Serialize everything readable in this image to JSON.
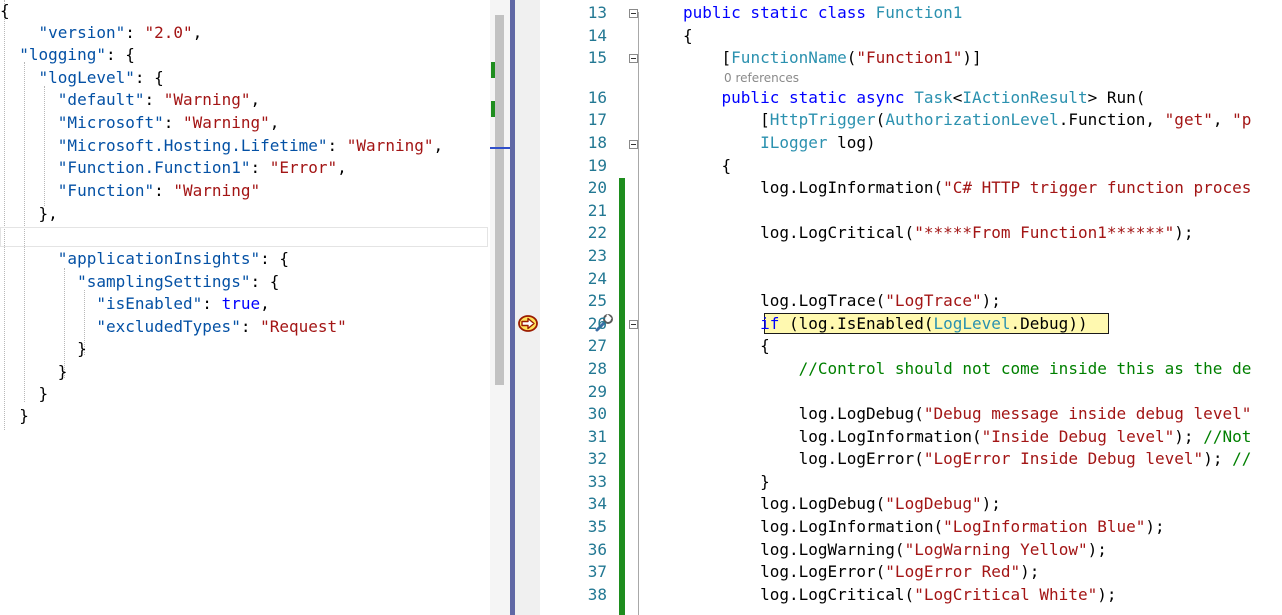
{
  "json_editor": {
    "lines": [
      [
        {
          "t": "{",
          "c": "pl"
        }
      ],
      [
        {
          "t": "    ",
          "c": "pl"
        },
        {
          "t": "\"version\"",
          "c": "jk"
        },
        {
          "t": ": ",
          "c": "pl"
        },
        {
          "t": "\"2.0\"",
          "c": "jv"
        },
        {
          "t": ",",
          "c": "pl"
        }
      ],
      [
        {
          "t": "  ",
          "c": "pl"
        },
        {
          "t": "\"logging\"",
          "c": "jk"
        },
        {
          "t": ": {",
          "c": "pl"
        }
      ],
      [
        {
          "t": "    ",
          "c": "pl"
        },
        {
          "t": "\"logLevel\"",
          "c": "jk"
        },
        {
          "t": ": {",
          "c": "pl"
        }
      ],
      [
        {
          "t": "      ",
          "c": "pl"
        },
        {
          "t": "\"default\"",
          "c": "jk"
        },
        {
          "t": ": ",
          "c": "pl"
        },
        {
          "t": "\"Warning\"",
          "c": "jv"
        },
        {
          "t": ",",
          "c": "pl"
        }
      ],
      [
        {
          "t": "      ",
          "c": "pl"
        },
        {
          "t": "\"Microsoft\"",
          "c": "jk"
        },
        {
          "t": ": ",
          "c": "pl"
        },
        {
          "t": "\"Warning\"",
          "c": "jv"
        },
        {
          "t": ",",
          "c": "pl"
        }
      ],
      [
        {
          "t": "      ",
          "c": "pl"
        },
        {
          "t": "\"Microsoft.Hosting.Lifetime\"",
          "c": "jk"
        },
        {
          "t": ": ",
          "c": "pl"
        },
        {
          "t": "\"Warning\"",
          "c": "jv"
        },
        {
          "t": ",",
          "c": "pl"
        }
      ],
      [
        {
          "t": "      ",
          "c": "pl"
        },
        {
          "t": "\"Function.Function1\"",
          "c": "jk"
        },
        {
          "t": ": ",
          "c": "pl"
        },
        {
          "t": "\"Error\"",
          "c": "jv"
        },
        {
          "t": ",",
          "c": "pl"
        }
      ],
      [
        {
          "t": "      ",
          "c": "pl"
        },
        {
          "t": "\"Function\"",
          "c": "jk"
        },
        {
          "t": ": ",
          "c": "pl"
        },
        {
          "t": "\"Warning\"",
          "c": "jv"
        }
      ],
      [
        {
          "t": "    },",
          "c": "pl"
        }
      ],
      [
        {
          "t": "",
          "c": "pl"
        }
      ],
      [
        {
          "t": "      ",
          "c": "pl"
        },
        {
          "t": "\"applicationInsights\"",
          "c": "jk"
        },
        {
          "t": ": {",
          "c": "pl"
        }
      ],
      [
        {
          "t": "        ",
          "c": "pl"
        },
        {
          "t": "\"samplingSettings\"",
          "c": "jk"
        },
        {
          "t": ": {",
          "c": "pl"
        }
      ],
      [
        {
          "t": "          ",
          "c": "pl"
        },
        {
          "t": "\"isEnabled\"",
          "c": "jk"
        },
        {
          "t": ": ",
          "c": "pl"
        },
        {
          "t": "true",
          "c": "jb"
        },
        {
          "t": ",",
          "c": "pl"
        }
      ],
      [
        {
          "t": "          ",
          "c": "pl"
        },
        {
          "t": "\"excludedTypes\"",
          "c": "jk"
        },
        {
          "t": ": ",
          "c": "pl"
        },
        {
          "t": "\"Request\"",
          "c": "jv"
        }
      ],
      [
        {
          "t": "        }",
          "c": "pl"
        }
      ],
      [
        {
          "t": "      }",
          "c": "pl"
        }
      ],
      [
        {
          "t": "    }",
          "c": "pl"
        }
      ],
      [
        {
          "t": "  }",
          "c": "pl"
        }
      ]
    ]
  },
  "code_editor": {
    "codelens_text": "0 references",
    "lines": [
      {
        "n": "13",
        "s": [
          {
            "t": "public static class ",
            "c": "kw"
          },
          {
            "t": "Function1",
            "c": "ty"
          }
        ]
      },
      {
        "n": "14",
        "s": [
          {
            "t": "{",
            "c": "pl"
          }
        ]
      },
      {
        "n": "15",
        "s": [
          {
            "t": "    [",
            "c": "pl"
          },
          {
            "t": "FunctionName",
            "c": "ty"
          },
          {
            "t": "(",
            "c": "pl"
          },
          {
            "t": "\"Function1\"",
            "c": "st"
          },
          {
            "t": ")]",
            "c": "pl"
          }
        ]
      },
      {
        "n": "16",
        "s": [
          {
            "t": "    public static async ",
            "c": "kw"
          },
          {
            "t": "Task",
            "c": "ty"
          },
          {
            "t": "<",
            "c": "pl"
          },
          {
            "t": "IActionResult",
            "c": "ty"
          },
          {
            "t": "> Run(",
            "c": "pl"
          }
        ]
      },
      {
        "n": "17",
        "s": [
          {
            "t": "        [",
            "c": "pl"
          },
          {
            "t": "HttpTrigger",
            "c": "ty"
          },
          {
            "t": "(",
            "c": "pl"
          },
          {
            "t": "AuthorizationLevel",
            "c": "ty"
          },
          {
            "t": ".Function, ",
            "c": "pl"
          },
          {
            "t": "\"get\"",
            "c": "st"
          },
          {
            "t": ", ",
            "c": "pl"
          },
          {
            "t": "\"p",
            "c": "st"
          }
        ]
      },
      {
        "n": "18",
        "s": [
          {
            "t": "        ",
            "c": "pl"
          },
          {
            "t": "ILogger",
            "c": "ty"
          },
          {
            "t": " log)",
            "c": "pl"
          }
        ]
      },
      {
        "n": "19",
        "s": [
          {
            "t": "    {",
            "c": "pl"
          }
        ]
      },
      {
        "n": "20",
        "s": [
          {
            "t": "        log.LogInformation(",
            "c": "pl"
          },
          {
            "t": "\"C# HTTP trigger function proces",
            "c": "st"
          }
        ]
      },
      {
        "n": "21",
        "s": [
          {
            "t": "",
            "c": "pl"
          }
        ]
      },
      {
        "n": "22",
        "s": [
          {
            "t": "        log.LogCritical(",
            "c": "pl"
          },
          {
            "t": "\"*****From Function1******\"",
            "c": "st"
          },
          {
            "t": ");",
            "c": "pl"
          }
        ]
      },
      {
        "n": "23",
        "s": [
          {
            "t": "",
            "c": "pl"
          }
        ]
      },
      {
        "n": "24",
        "s": [
          {
            "t": "",
            "c": "pl"
          }
        ]
      },
      {
        "n": "25",
        "s": [
          {
            "t": "        log.LogTrace(",
            "c": "pl"
          },
          {
            "t": "\"LogTrace\"",
            "c": "st"
          },
          {
            "t": ");",
            "c": "pl"
          }
        ]
      },
      {
        "n": "26",
        "s": [
          {
            "t": "        ",
            "c": "pl"
          },
          {
            "t": "if",
            "c": "kw"
          },
          {
            "t": " (log.IsEnabled(",
            "c": "pl"
          },
          {
            "t": "LogLevel",
            "c": "ty"
          },
          {
            "t": ".Debug))",
            "c": "pl"
          }
        ]
      },
      {
        "n": "27",
        "s": [
          {
            "t": "        {",
            "c": "pl"
          }
        ]
      },
      {
        "n": "28",
        "s": [
          {
            "t": "            //Control should not come inside this as the de",
            "c": "cm"
          }
        ]
      },
      {
        "n": "29",
        "s": [
          {
            "t": "",
            "c": "pl"
          }
        ]
      },
      {
        "n": "30",
        "s": [
          {
            "t": "            log.LogDebug(",
            "c": "pl"
          },
          {
            "t": "\"Debug message inside debug level\"",
            "c": "st"
          }
        ]
      },
      {
        "n": "31",
        "s": [
          {
            "t": "            log.LogInformation(",
            "c": "pl"
          },
          {
            "t": "\"Inside Debug level\"",
            "c": "st"
          },
          {
            "t": "); ",
            "c": "pl"
          },
          {
            "t": "//Not",
            "c": "cm"
          }
        ]
      },
      {
        "n": "32",
        "s": [
          {
            "t": "            log.LogError(",
            "c": "pl"
          },
          {
            "t": "\"LogError Inside Debug level\"",
            "c": "st"
          },
          {
            "t": "); ",
            "c": "pl"
          },
          {
            "t": "//",
            "c": "cm"
          }
        ]
      },
      {
        "n": "33",
        "s": [
          {
            "t": "        }",
            "c": "pl"
          }
        ]
      },
      {
        "n": "34",
        "s": [
          {
            "t": "        log.LogDebug(",
            "c": "pl"
          },
          {
            "t": "\"LogDebug\"",
            "c": "st"
          },
          {
            "t": ");",
            "c": "pl"
          }
        ]
      },
      {
        "n": "35",
        "s": [
          {
            "t": "        log.LogInformation(",
            "c": "pl"
          },
          {
            "t": "\"LogInformation Blue\"",
            "c": "st"
          },
          {
            "t": ");",
            "c": "pl"
          }
        ]
      },
      {
        "n": "36",
        "s": [
          {
            "t": "        log.LogWarning(",
            "c": "pl"
          },
          {
            "t": "\"LogWarning Yellow\"",
            "c": "st"
          },
          {
            "t": ");",
            "c": "pl"
          }
        ]
      },
      {
        "n": "37",
        "s": [
          {
            "t": "        log.LogError(",
            "c": "pl"
          },
          {
            "t": "\"LogError Red\"",
            "c": "st"
          },
          {
            "t": ");",
            "c": "pl"
          }
        ]
      },
      {
        "n": "38",
        "s": [
          {
            "t": "        log.LogCritical(",
            "c": "pl"
          },
          {
            "t": "\"LogCritical White\"",
            "c": "st"
          },
          {
            "t": ");",
            "c": "pl"
          }
        ]
      }
    ]
  },
  "icons": {
    "execution_pointer": "current-statement-arrow-icon",
    "quick_actions": "screwdriver-wrench-icon"
  },
  "colors": {
    "keyword": "#0000ff",
    "type": "#2b91af",
    "string": "#a31515",
    "comment": "#008000",
    "line_number": "#237893",
    "change_bar": "#1e8d1e",
    "current_line_highlight": "#fff9b0",
    "splitter": "#6068a5"
  }
}
